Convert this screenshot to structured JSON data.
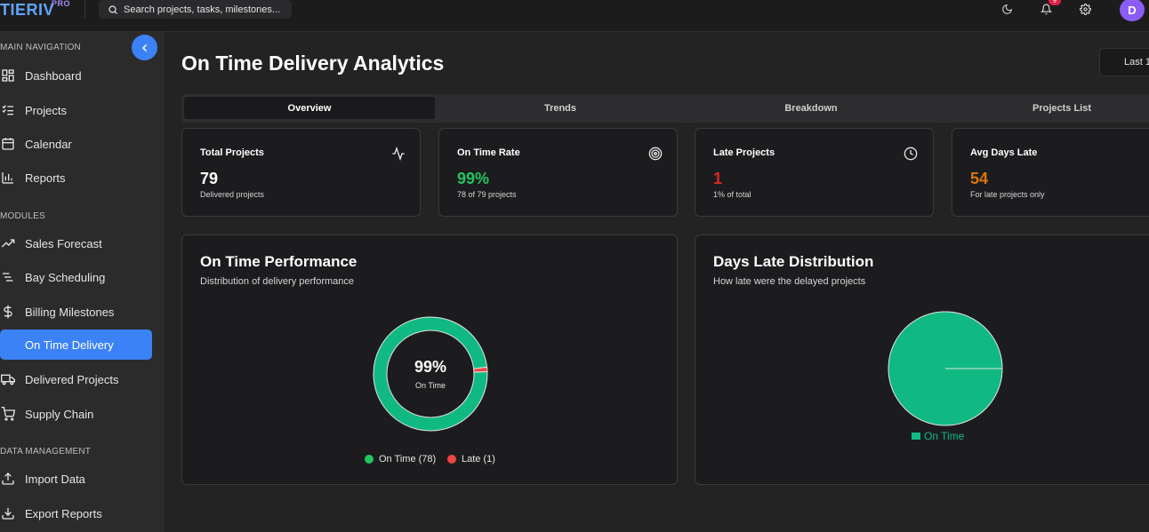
{
  "app": {
    "logo": "TIERIV",
    "logo_badge": "PRO",
    "search_placeholder": "Search projects, tasks, milestones...",
    "notification_count": "9",
    "avatar_initial": "D"
  },
  "sidebar": {
    "sections": [
      {
        "title": "MAIN NAVIGATION",
        "items": [
          "Dashboard",
          "Projects",
          "Calendar",
          "Reports"
        ]
      },
      {
        "title": "MODULES",
        "items": [
          "Sales Forecast",
          "Bay Scheduling",
          "Billing Milestones",
          "On Time Delivery",
          "Delivered Projects",
          "Supply Chain"
        ]
      },
      {
        "title": "DATA MANAGEMENT",
        "items": [
          "Import Data",
          "Export Reports"
        ]
      }
    ],
    "active_item": "On Time Delivery"
  },
  "page": {
    "title": "On Time Delivery Analytics",
    "range_button": "Last 1"
  },
  "tabs": [
    "Overview",
    "Trends",
    "Breakdown",
    "Projects List"
  ],
  "active_tab": "Overview",
  "stats": [
    {
      "title": "Total Projects",
      "value": "79",
      "sub": "Delivered projects",
      "icon": "activity-icon",
      "color": "#ffffff"
    },
    {
      "title": "On Time Rate",
      "value": "99%",
      "sub": "78 of 79 projects",
      "icon": "target-icon",
      "color": "#22c55e"
    },
    {
      "title": "Late Projects",
      "value": "1",
      "sub": "1% of total",
      "icon": "clock-icon",
      "color": "#dc2626"
    },
    {
      "title": "Avg Days Late",
      "value": "54",
      "sub": "For late projects only",
      "icon": "",
      "color": "#d97706"
    }
  ],
  "performance_chart": {
    "title": "On Time Performance",
    "subtitle": "Distribution of delivery performance",
    "center_value": "99%",
    "center_label": "On Time",
    "legend": [
      {
        "label": "On Time (78)",
        "color": "#22c55e"
      },
      {
        "label": "Late (1)",
        "color": "#ef4444"
      }
    ]
  },
  "distribution_chart": {
    "title": "Days Late Distribution",
    "subtitle": "How late were the delayed projects",
    "legend_label": "On Time",
    "color": "#10b981"
  },
  "chart_data": [
    {
      "type": "pie",
      "title": "On Time Performance",
      "categories": [
        "On Time",
        "Late"
      ],
      "values": [
        78,
        1
      ],
      "colors": [
        "#10b981",
        "#ef4444"
      ],
      "donut": true
    },
    {
      "type": "pie",
      "title": "Days Late Distribution",
      "categories": [
        "On Time"
      ],
      "values": [
        78
      ],
      "colors": [
        "#10b981"
      ]
    }
  ]
}
